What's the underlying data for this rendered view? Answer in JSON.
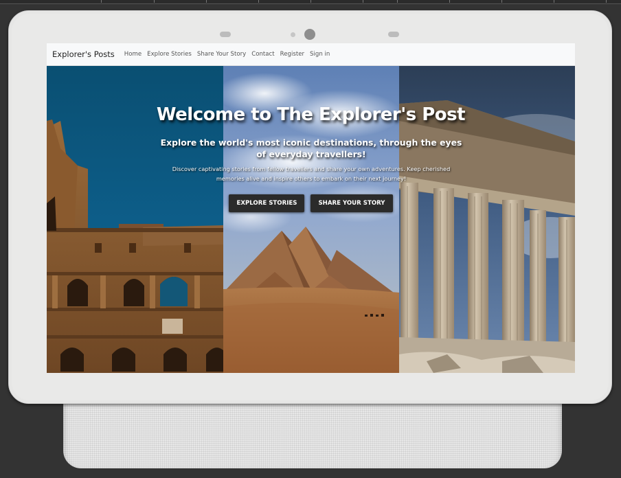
{
  "navbar": {
    "brand": "Explorer's Posts",
    "links": [
      "Home",
      "Explore Stories",
      "Share Your Story",
      "Contact",
      "Register",
      "Sign in"
    ]
  },
  "hero": {
    "title": "Welcome to The Explorer's Post",
    "subtitle": "Explore the world's most iconic destinations, through the eyes of everyday travellers!",
    "description": "Discover captivating stories from fellow travellers and share your own adventures. Keep cherished memories alive and inspire others to embark on their next journey!",
    "buttons": [
      "EXPLORE STORIES",
      "SHARE YOUR STORY"
    ]
  },
  "colors": {
    "page_background": "#333333",
    "device_frame": "#e6e6e5",
    "navbar_background": "#f8f9fa",
    "button_background": "#2b2b2b"
  }
}
